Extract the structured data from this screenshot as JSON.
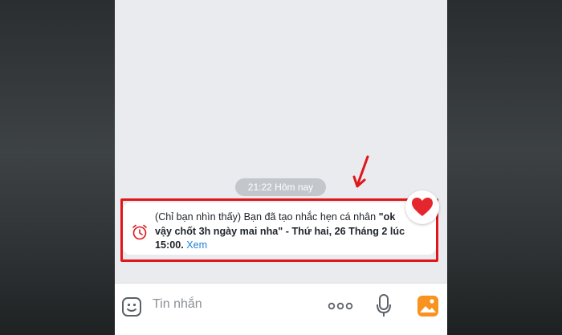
{
  "chat": {
    "timestamp": "21:22 Hôm nay",
    "reminder": {
      "line1_prefix": "(Chỉ bạn nhìn thấy) Bạn đã tạo nhắc hẹn cá nhân ",
      "line1_bold": "\"ok",
      "line2_bold": "vậy chốt 3h ngày mai nha\"",
      "line2_rest": " - Thứ hai, 26 Tháng 2 lúc",
      "line3_bold": "15:00.",
      "view_link": "Xem",
      "icon": "alarm-clock-icon"
    },
    "reaction_icon": "heart-icon"
  },
  "composer": {
    "placeholder": "Tin nhắn",
    "icons": [
      "sticker-icon",
      "more-icon",
      "mic-icon",
      "image-icon"
    ]
  },
  "colors": {
    "highlight_border": "#e0161b",
    "link": "#1d7fd6",
    "image_button": "#f7931e",
    "heart": "#e5262d"
  }
}
